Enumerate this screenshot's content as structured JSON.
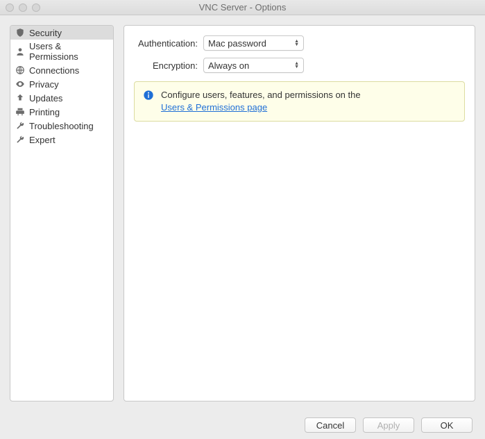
{
  "window": {
    "title": "VNC Server - Options"
  },
  "sidebar": {
    "items": [
      {
        "label": "Security",
        "icon": "shield-icon",
        "selected": true
      },
      {
        "label": "Users & Permissions",
        "icon": "user-icon",
        "selected": false
      },
      {
        "label": "Connections",
        "icon": "globe-icon",
        "selected": false
      },
      {
        "label": "Privacy",
        "icon": "eye-icon",
        "selected": false
      },
      {
        "label": "Updates",
        "icon": "up-arrow-icon",
        "selected": false
      },
      {
        "label": "Printing",
        "icon": "printer-icon",
        "selected": false
      },
      {
        "label": "Troubleshooting",
        "icon": "wrench-icon",
        "selected": false
      },
      {
        "label": "Expert",
        "icon": "wrench-icon",
        "selected": false
      }
    ]
  },
  "form": {
    "authentication": {
      "label": "Authentication:",
      "value": "Mac password"
    },
    "encryption": {
      "label": "Encryption:",
      "value": "Always on"
    }
  },
  "info": {
    "text": "Configure users, features, and permissions on the",
    "link": "Users & Permissions page"
  },
  "buttons": {
    "cancel": "Cancel",
    "apply": "Apply",
    "ok": "OK"
  }
}
